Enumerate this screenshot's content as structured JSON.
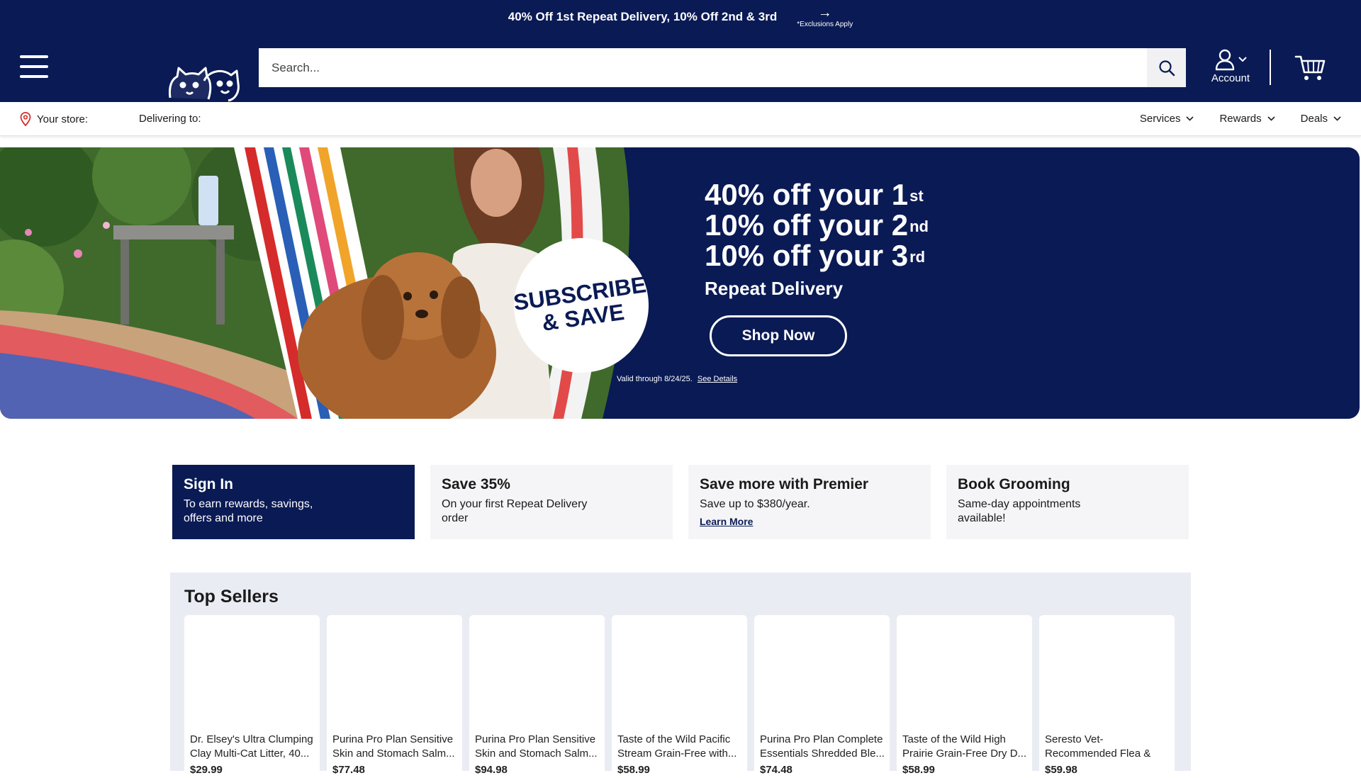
{
  "promo": {
    "text": "40% Off 1st Repeat Delivery, 10% Off 2nd & 3rd",
    "arrow_icon": "arrow-right-icon",
    "note": "*Exclusions Apply"
  },
  "header": {
    "search_placeholder": "Search...",
    "account_label": "Account"
  },
  "subnav": {
    "store_label": "Your store:",
    "delivering_label": "Delivering to:",
    "links": [
      "Services",
      "Rewards",
      "Deals"
    ]
  },
  "hero": {
    "badge_line1": "SUBSCRIBE",
    "badge_line2": "& SAVE",
    "line1": "40% off your 1",
    "line1_sup": "st",
    "line2": "10% off your 2",
    "line2_sup": "nd",
    "line3": "10% off your 3",
    "line3_sup": "rd",
    "subtitle": "Repeat Delivery",
    "cta": "Shop Now",
    "valid_text": "Valid through 8/24/25.",
    "details_link": "See Details"
  },
  "cards": [
    {
      "title": "Sign In",
      "sub": "To earn rewards, savings, offers and more",
      "link": ""
    },
    {
      "title": "Save 35%",
      "sub": "On your first Repeat Delivery order",
      "link": ""
    },
    {
      "title": "Save more with Premier",
      "sub": "Save up to $380/year.",
      "link": "Learn More"
    },
    {
      "title": "Book Grooming",
      "sub": "Same-day appointments available!",
      "link": ""
    }
  ],
  "top_sellers": {
    "title": "Top Sellers",
    "products": [
      {
        "name": "Dr. Elsey's Ultra Clumping Clay Multi-Cat Litter, 40...",
        "price": "$29.99"
      },
      {
        "name": "Purina Pro Plan Sensitive Skin and Stomach Salm...",
        "price": "$77.48"
      },
      {
        "name": "Purina Pro Plan Sensitive Skin and Stomach Salm...",
        "price": "$94.98"
      },
      {
        "name": "Taste of the Wild Pacific Stream Grain-Free with...",
        "price": "$58.99"
      },
      {
        "name": "Purina Pro Plan Complete Essentials Shredded Ble...",
        "price": "$74.48"
      },
      {
        "name": "Taste of the Wild High Prairie Grain-Free Dry D...",
        "price": "$58.99"
      },
      {
        "name": "Seresto Vet-Recommended Flea & Ti...",
        "price": "$59.98"
      }
    ]
  },
  "colors": {
    "brand_navy": "#0a1a55",
    "card_gray": "#f5f5f7",
    "sellers_bg": "#e9ecf3"
  }
}
